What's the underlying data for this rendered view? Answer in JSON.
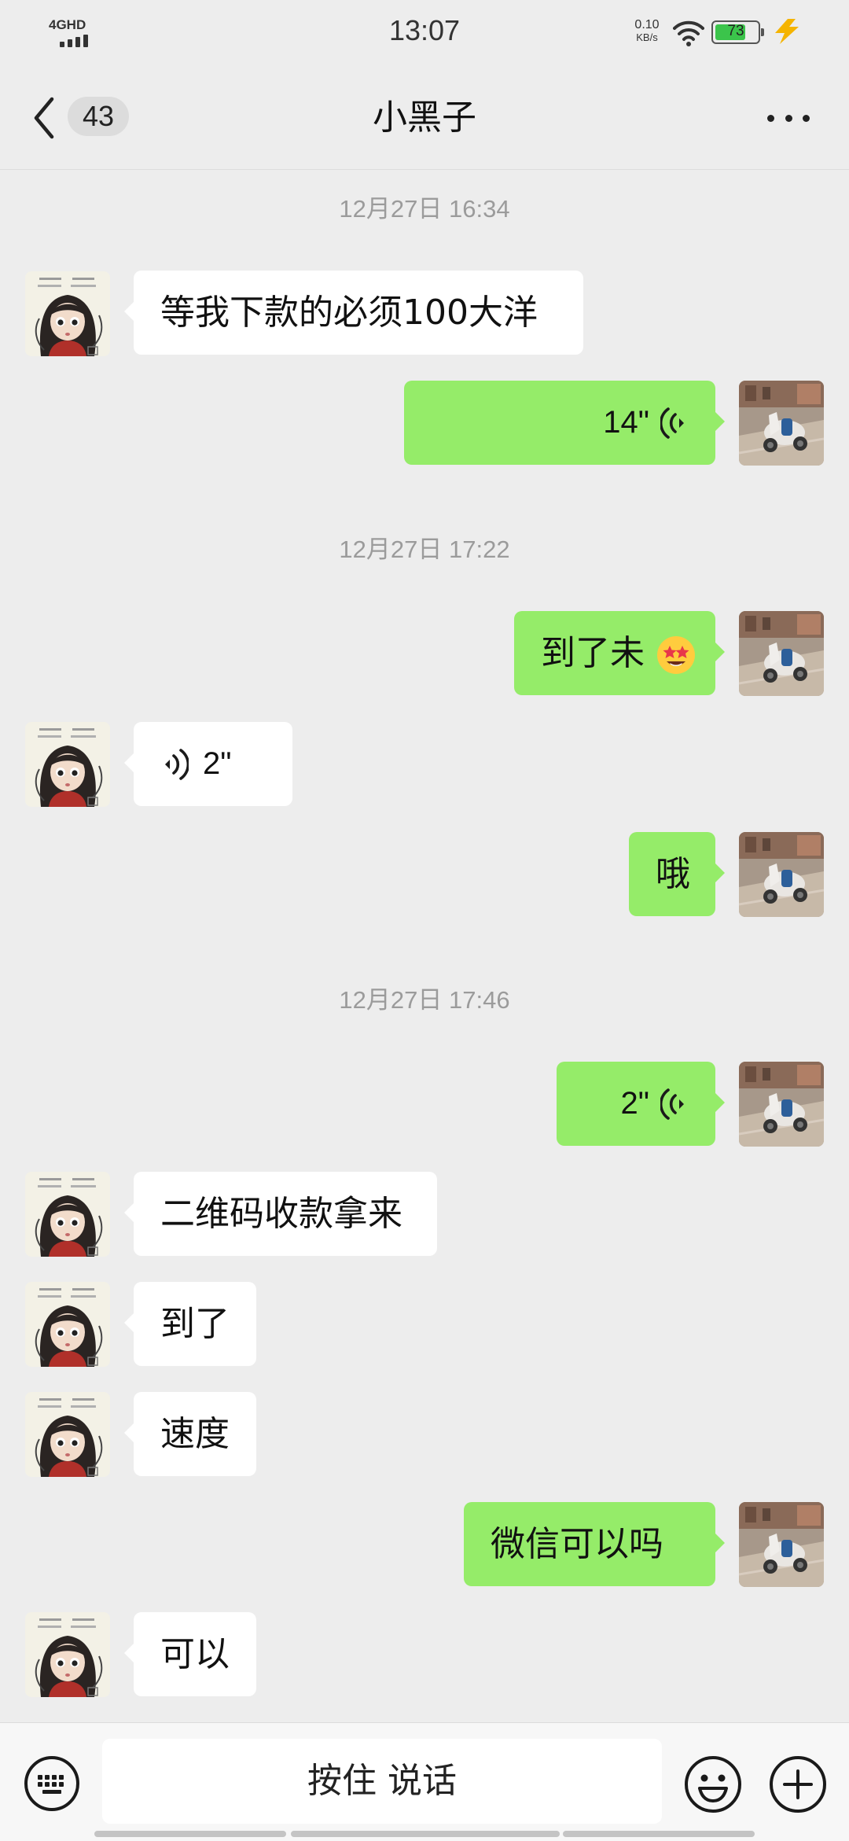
{
  "status_bar": {
    "network": "4GHD",
    "time": "13:07",
    "speed_value": "0.10",
    "speed_unit": "KB/s",
    "battery": "73",
    "battery_level": 0.73
  },
  "header": {
    "unread_count": "43",
    "title": "小黑子"
  },
  "messages": {
    "ts1": "12月27日 16:34",
    "m1": "等我下款的必须100大洋",
    "m2_duration": "14\"",
    "ts2": "12月27日 17:22",
    "m3": "到了未",
    "m3_emoji": "star-struck-face-emoji",
    "m4_duration": "2\"",
    "m5": "哦",
    "ts3": "12月27日 17:46",
    "m6_duration": "2\"",
    "m7": "二维码收款拿来",
    "m8": "到了",
    "m9": "速度",
    "m10": "微信可以吗",
    "m11": "可以"
  },
  "input_bar": {
    "talk_label": "按住 说话"
  },
  "icons": {
    "back": "chevron-left-icon",
    "more": "more-dots-icon",
    "keyboard": "keyboard-icon",
    "emoji": "emoji-icon",
    "plus": "plus-icon",
    "voice": "voice-wave-icon"
  },
  "colors": {
    "background": "#ededed",
    "outgoing_bubble": "#95ec69",
    "incoming_bubble": "#ffffff",
    "timestamp_text": "#9b9b9b"
  }
}
